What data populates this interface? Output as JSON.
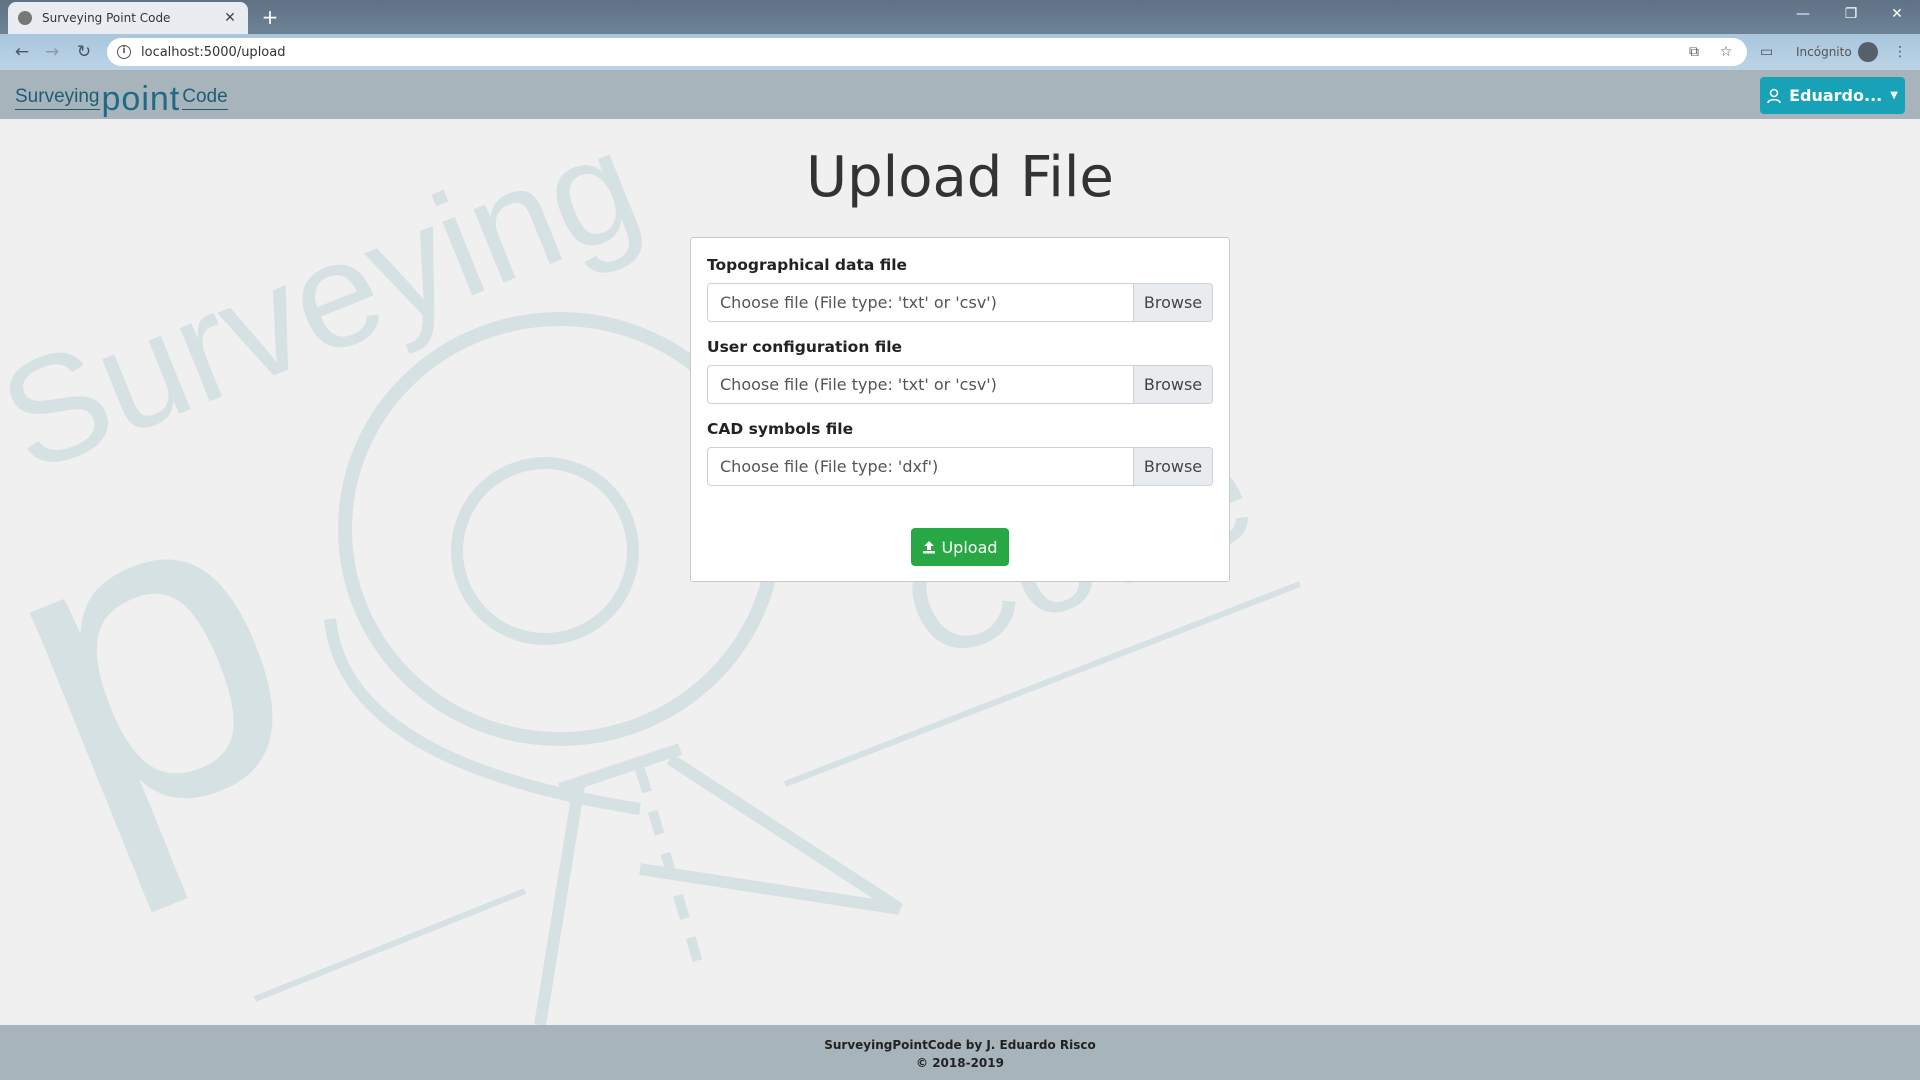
{
  "browser": {
    "tab_title": "Surveying Point Code",
    "url": "localhost:5000/upload",
    "incognito_label": "Incógnito"
  },
  "navbar": {
    "logo": {
      "part1": "Surveying",
      "part2": "point",
      "part3": "Code"
    },
    "user_button_label": "Eduardo...",
    "accent_color": "#17a2b8"
  },
  "watermark": {
    "word1": "Surveying",
    "word2": "p",
    "word3": "Code"
  },
  "page": {
    "title": "Upload File",
    "fields": [
      {
        "label": "Topographical data file",
        "placeholder": "Choose file (File type: 'txt' or 'csv')",
        "browse": "Browse"
      },
      {
        "label": "User configuration file",
        "placeholder": "Choose file (File type: 'txt' or 'csv')",
        "browse": "Browse"
      },
      {
        "label": "CAD symbols file",
        "placeholder": "Choose file (File type: 'dxf')",
        "browse": "Browse"
      }
    ],
    "upload_button": "Upload",
    "upload_color": "#28a745"
  },
  "footer": {
    "line1": "SurveyingPointCode by J. Eduardo Risco",
    "line2": "© 2018-2019"
  }
}
